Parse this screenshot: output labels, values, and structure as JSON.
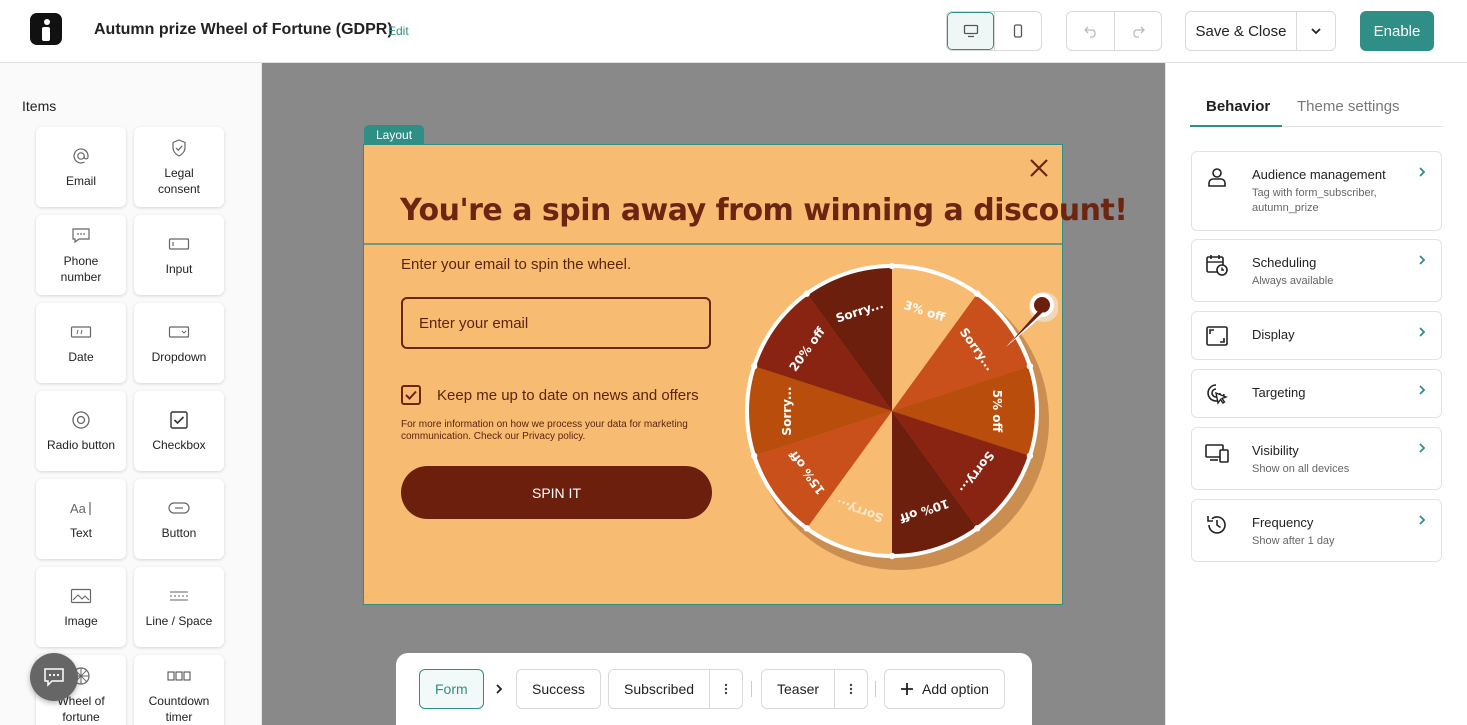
{
  "header": {
    "title": "Autumn prize Wheel of Fortune (GDPR)",
    "edit_label": "Edit",
    "save_label": "Save & Close",
    "enable_label": "Enable"
  },
  "left": {
    "title": "Items",
    "items": [
      {
        "label": "Email",
        "icon": "at-icon"
      },
      {
        "label": "Legal consent",
        "icon": "shield-check-icon"
      },
      {
        "label": "Phone number",
        "icon": "message-icon"
      },
      {
        "label": "Input",
        "icon": "input-icon"
      },
      {
        "label": "Date",
        "icon": "date-field-icon"
      },
      {
        "label": "Dropdown",
        "icon": "dropdown-icon"
      },
      {
        "label": "Radio button",
        "icon": "radio-icon"
      },
      {
        "label": "Checkbox",
        "icon": "checkbox-icon"
      },
      {
        "label": "Text",
        "icon": "text-icon"
      },
      {
        "label": "Button",
        "icon": "button-icon"
      },
      {
        "label": "Image",
        "icon": "image-icon"
      },
      {
        "label": "Line / Space",
        "icon": "line-space-icon"
      },
      {
        "label": "Wheel of fortune",
        "icon": "wheel-icon"
      },
      {
        "label": "Countdown timer",
        "icon": "countdown-icon"
      }
    ]
  },
  "canvas": {
    "layout_tag": "Layout",
    "headline": "You're a spin away from winning a discount!",
    "subtext": "Enter your email to spin the wheel.",
    "email_placeholder": "Enter your email",
    "checkbox_label": "Keep me up to date on news and offers",
    "legal_text": "For more information on how we process your data for marketing communication. Check our Privacy policy.",
    "spin_label": "SPIN IT",
    "wheel_segments": [
      "3% off",
      "Sorry...",
      "5% off",
      "Sorry...",
      "10% off",
      "Sorry...",
      "15% off",
      "Sorry...",
      "20% off",
      "Sorry..."
    ],
    "wheel_colors": [
      "#f8bb72",
      "#c9501a",
      "#b94d0c",
      "#8a2412",
      "#6b1f0c",
      "#f8bb72",
      "#c9501a",
      "#b94d0c",
      "#8a2412",
      "#6b1f0c"
    ]
  },
  "bottom": {
    "tabs": [
      "Form",
      "Success",
      "Subscribed",
      "Teaser"
    ],
    "add_option": "Add option"
  },
  "right": {
    "tabs": [
      "Behavior",
      "Theme settings"
    ],
    "settings": [
      {
        "title": "Audience management",
        "desc": "Tag with form_subscriber, autumn_prize",
        "icon": "person-icon"
      },
      {
        "title": "Scheduling",
        "desc": "Always available",
        "icon": "calendar-clock-icon"
      },
      {
        "title": "Display",
        "desc": "",
        "icon": "display-frame-icon"
      },
      {
        "title": "Targeting",
        "desc": "",
        "icon": "cursor-target-icon"
      },
      {
        "title": "Visibility",
        "desc": "Show on all devices",
        "icon": "devices-icon"
      },
      {
        "title": "Frequency",
        "desc": "Show after 1 day",
        "icon": "history-icon"
      }
    ]
  },
  "colors": {
    "accent": "#2f8f87",
    "popup_bg": "#f8bb72",
    "brand_brown": "#6b1f0c"
  }
}
